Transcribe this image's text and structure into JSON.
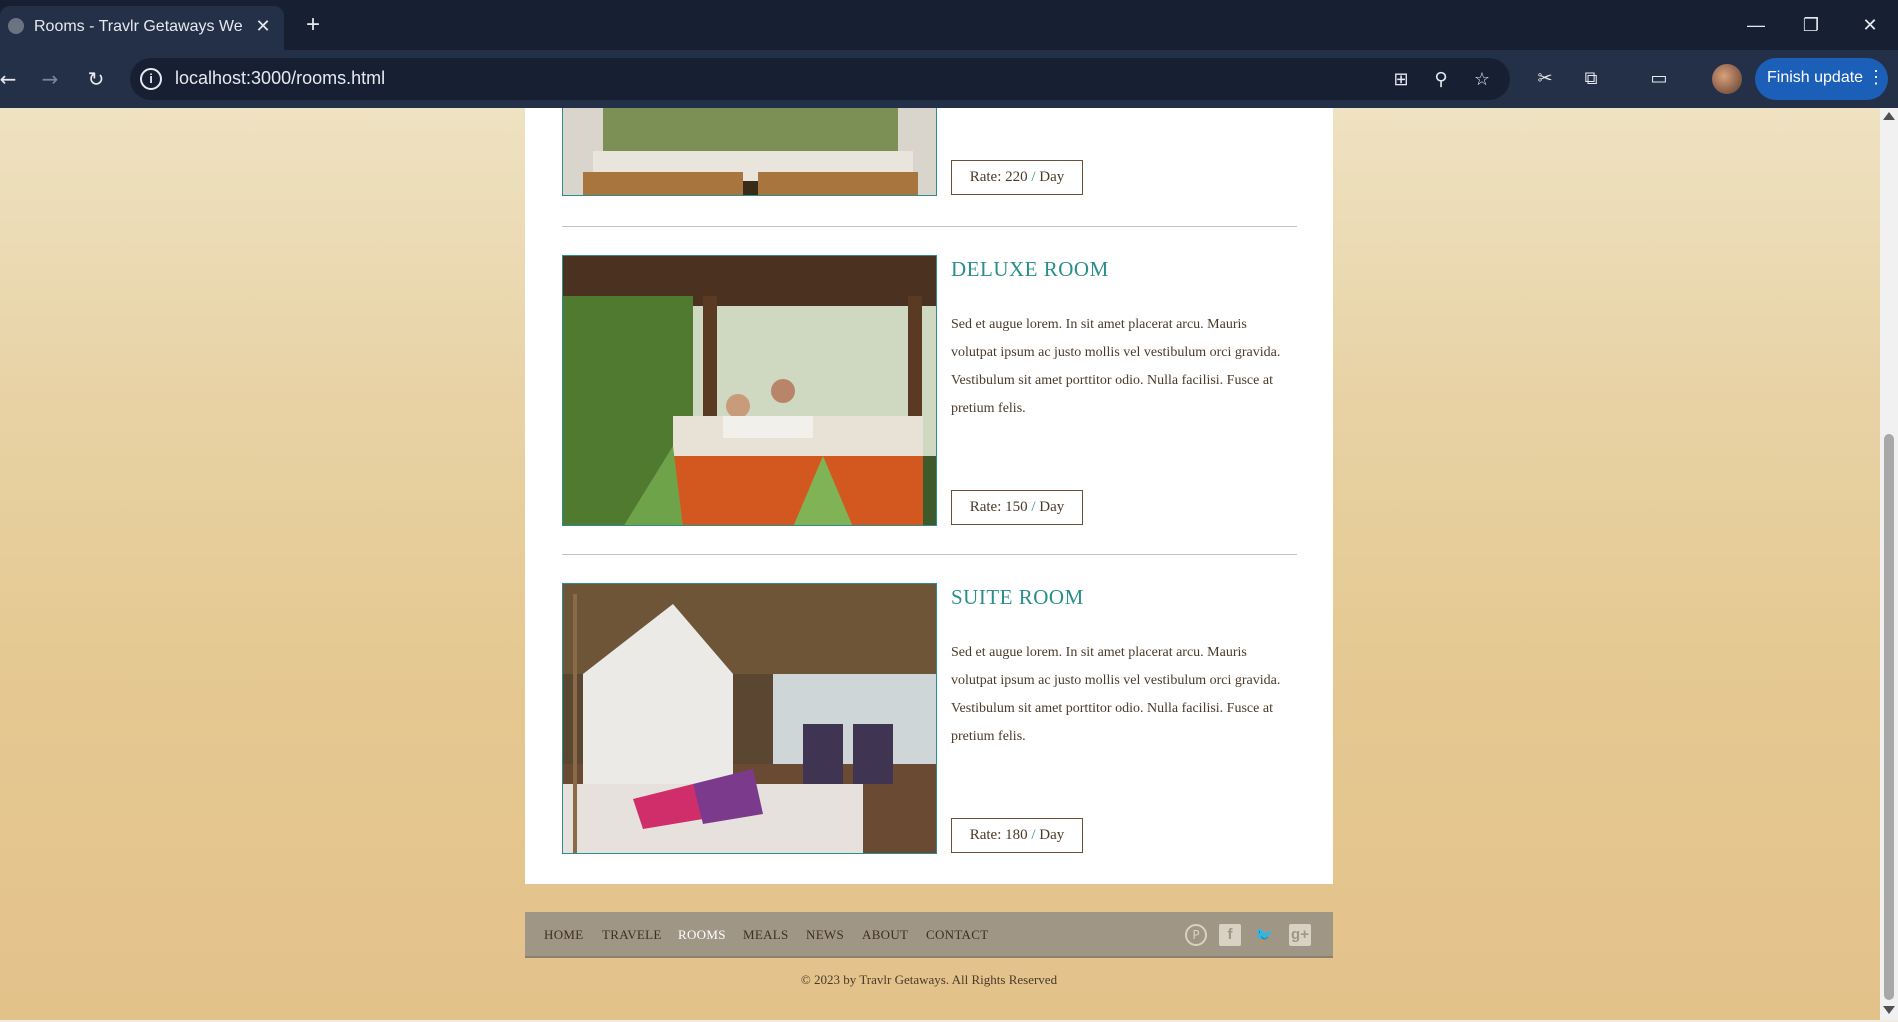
{
  "browser": {
    "tab_title": "Rooms - Travlr Getaways Websi",
    "url": "localhost:3000/rooms.html",
    "update_label": "Finish update",
    "icons": [
      "back-icon",
      "forward-icon",
      "reload-icon",
      "site-info-icon",
      "translate-icon",
      "zoom-icon",
      "bookmark-star-icon",
      "extension-icon",
      "puzzle-icon",
      "cast-icon",
      "profile-avatar",
      "menu-dots-icon"
    ]
  },
  "rooms": [
    {
      "name": "",
      "description": "",
      "rate": {
        "prefix": "Rate: 220 ",
        "slash": "/",
        "suffix": " Day"
      }
    },
    {
      "name": "DELUXE ROOM",
      "description": "Sed et augue lorem. In sit amet placerat arcu. Mauris volutpat ipsum ac justo mollis vel vestibulum orci gravida. Vestibulum sit amet porttitor odio. Nulla facilisi. Fusce at pretium felis.",
      "rate": {
        "prefix": "Rate: 150 ",
        "slash": "/",
        "suffix": " Day"
      }
    },
    {
      "name": "SUITE ROOM",
      "description": "Sed et augue lorem. In sit amet placerat arcu. Mauris volutpat ipsum ac justo mollis vel vestibulum orci gravida. Vestibulum sit amet porttitor odio. Nulla facilisi. Fusce at pretium felis.",
      "rate": {
        "prefix": "Rate: 180 ",
        "slash": "/",
        "suffix": " Day"
      }
    }
  ],
  "footer": {
    "nav": [
      "HOME",
      "TRAVELE",
      "ROOMS",
      "MEALS",
      "NEWS",
      "ABOUT",
      "CONTACT"
    ],
    "active": "ROOMS",
    "social": [
      "pinterest-icon",
      "facebook-icon",
      "twitter-icon",
      "google-plus-icon"
    ],
    "copyright": "© 2023 by Travlr Getaways. All Rights Reserved"
  },
  "colors": {
    "accent": "#2a8f8a",
    "footer_bg": "#a09685",
    "text": "#4a3a2a"
  }
}
